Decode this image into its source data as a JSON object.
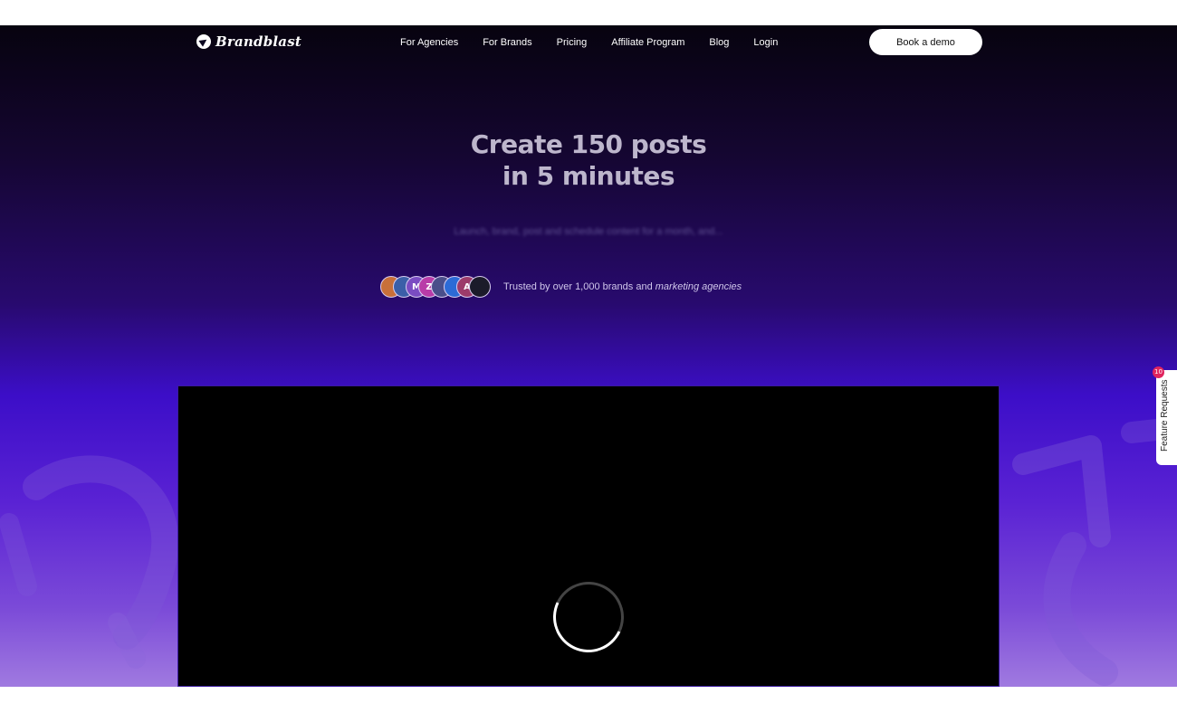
{
  "nav": {
    "brand": "Brandblast",
    "links": [
      "For Agencies",
      "For Brands",
      "Pricing",
      "Affiliate Program",
      "Blog",
      "Login"
    ],
    "cta": "Book a demo"
  },
  "hero": {
    "title_line1": "Create 150 posts",
    "title_line2": "in 5 minutes",
    "subtitle": "Launch, brand, post and schedule content for a month, and..."
  },
  "trust": {
    "text_plain": "Trusted by over 1,000 brands and",
    "text_emphasis": "marketing agencies",
    "avatars": [
      {
        "label": "",
        "color": "#c8703a"
      },
      {
        "label": "",
        "color": "#3b5fa8"
      },
      {
        "label": "M",
        "color": "#7a4cc2"
      },
      {
        "label": "Z",
        "color": "#b93ca8"
      },
      {
        "label": "",
        "color": "#4a4f8a"
      },
      {
        "label": "",
        "color": "#2c6bd6"
      },
      {
        "label": "A",
        "color": "#9c3b6a"
      },
      {
        "label": "",
        "color": "#1b1b2a"
      }
    ]
  },
  "feature_requests": {
    "label": "Feature Requests",
    "badge": "10"
  },
  "colors": {
    "accent": "#3c0ec8",
    "button_bg": "#ffffff"
  }
}
